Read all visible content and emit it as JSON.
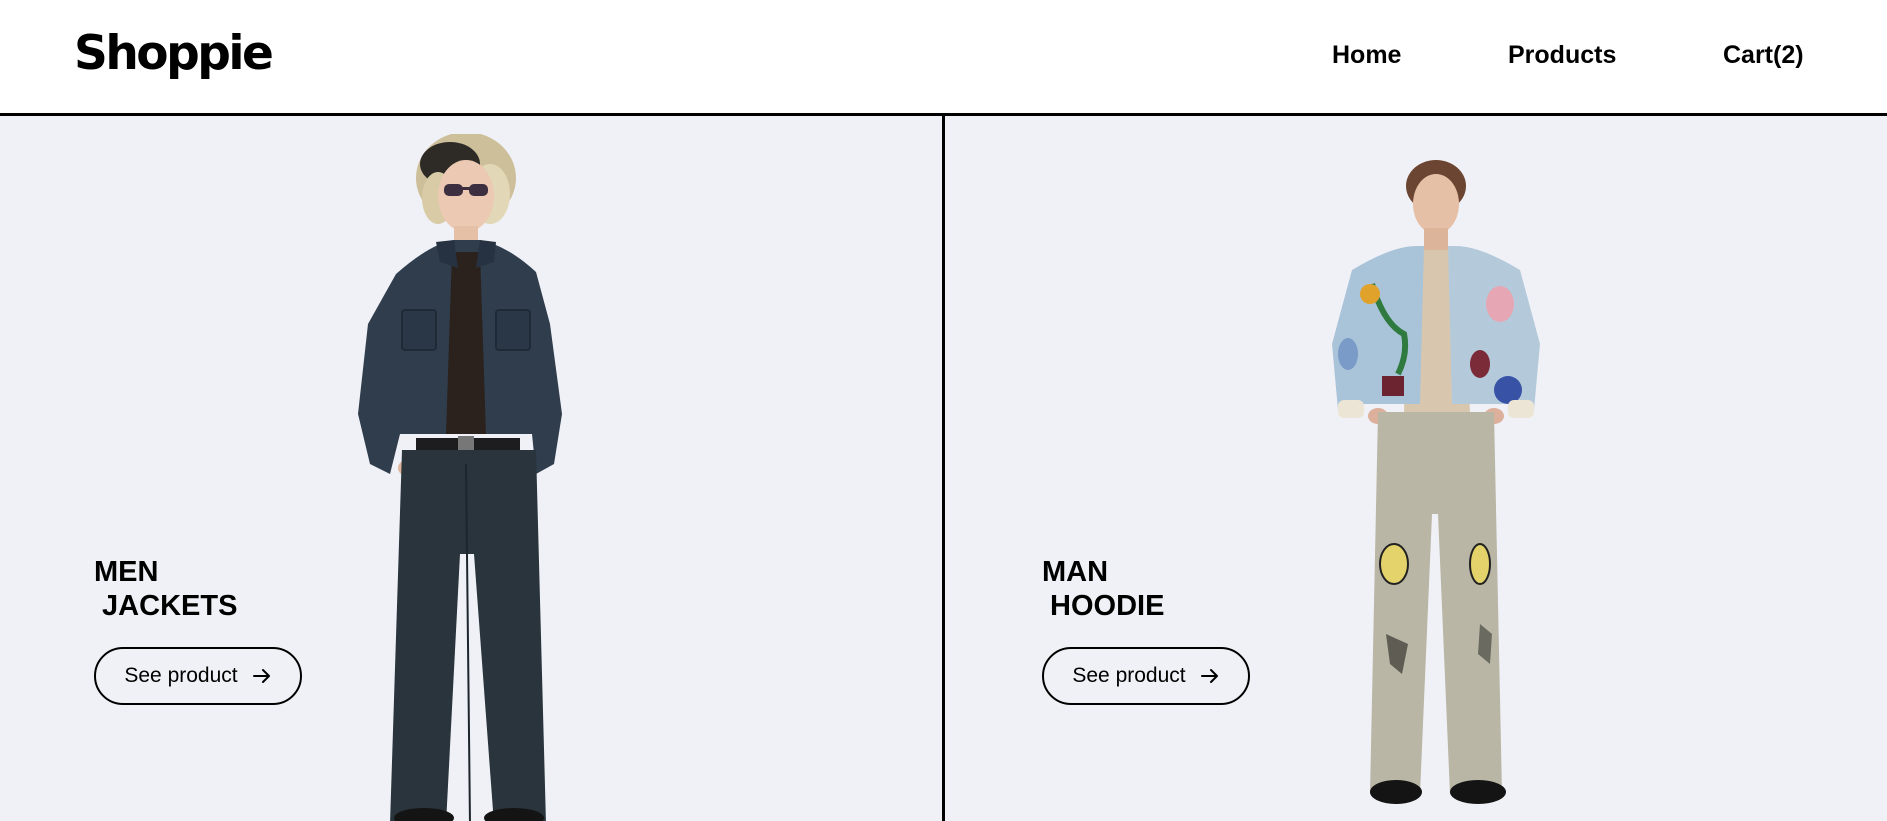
{
  "header": {
    "logo": "Shoppie",
    "nav": {
      "home": "Home",
      "products": "Products",
      "cart": "Cart(2)"
    }
  },
  "products": [
    {
      "title": "MEN\n JACKETS",
      "button_label": "See product",
      "button_icon": "arrow-right-icon",
      "image": "model-denim-jacket-image"
    },
    {
      "title": "MAN\n HOODIE",
      "button_label": "See product",
      "button_icon": "arrow-right-icon",
      "image": "model-printed-hoodie-image"
    }
  ],
  "colors": {
    "panel_background": "#f0f1f6",
    "header_background": "#ffffff",
    "text": "#000000",
    "divider": "#000000"
  }
}
